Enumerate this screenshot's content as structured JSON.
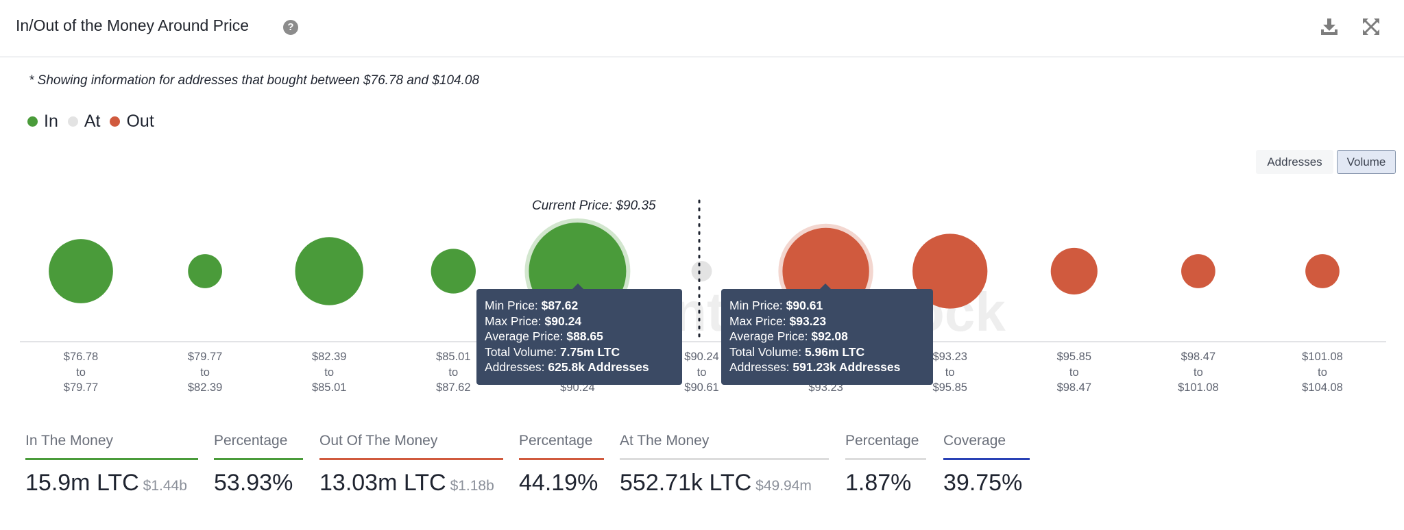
{
  "header": {
    "title": "In/Out of the Money Around Price",
    "help_icon": "question-circle-icon",
    "download_icon": "download-icon",
    "expand_icon": "expand-arrows-icon"
  },
  "note": "* Showing information for addresses that bought between $76.78 and $104.08",
  "legend": [
    {
      "label": "In",
      "color": "#4a9b3a"
    },
    {
      "label": "At",
      "color": "#e3e3e3"
    },
    {
      "label": "Out",
      "color": "#d05a3e"
    }
  ],
  "toggle": {
    "addresses_label": "Addresses",
    "volume_label": "Volume",
    "selected": "Volume"
  },
  "watermark": "IntoTheBlock",
  "chart_data": {
    "type": "bubble",
    "title": "In/Out of the Money Around Price",
    "current_price_label": "Current Price: $90.35",
    "current_price": 90.35,
    "size_metric": "Volume",
    "colors": {
      "In": "#4a9b3a",
      "At": "#e3e3e3",
      "Out": "#d05a3e"
    },
    "buckets": [
      {
        "from": "$76.78",
        "to": "$79.77",
        "status": "In",
        "relative_size": 0.66
      },
      {
        "from": "$79.77",
        "to": "$82.39",
        "status": "In",
        "relative_size": 0.35
      },
      {
        "from": "$82.39",
        "to": "$85.01",
        "status": "In",
        "relative_size": 0.7
      },
      {
        "from": "$85.01",
        "to": "$87.62",
        "status": "In",
        "relative_size": 0.46
      },
      {
        "from": "$87.62",
        "to": "$90.24",
        "status": "In",
        "relative_size": 1.0,
        "highlighted": true,
        "tooltip": {
          "min_price": "$87.62",
          "max_price": "$90.24",
          "avg_price": "$88.65",
          "total_volume": "7.75m LTC",
          "addresses": "625.8k Addresses"
        }
      },
      {
        "from": "$90.24",
        "to": "$90.61",
        "status": "At",
        "relative_size": 0.21
      },
      {
        "from": "$90.61",
        "to": "$93.23",
        "status": "Out",
        "relative_size": 0.89,
        "highlighted": true,
        "tooltip": {
          "min_price": "$90.61",
          "max_price": "$93.23",
          "avg_price": "$92.08",
          "total_volume": "5.96m LTC",
          "addresses": "591.23k Addresses"
        }
      },
      {
        "from": "$93.23",
        "to": "$95.85",
        "status": "Out",
        "relative_size": 0.77
      },
      {
        "from": "$95.85",
        "to": "$98.47",
        "status": "Out",
        "relative_size": 0.48
      },
      {
        "from": "$98.47",
        "to": "$101.08",
        "status": "Out",
        "relative_size": 0.35
      },
      {
        "from": "$101.08",
        "to": "$104.08",
        "status": "Out",
        "relative_size": 0.35
      }
    ],
    "tooltip_labels": {
      "min_price": "Min Price:",
      "max_price": "Max Price:",
      "avg_price": "Average Price:",
      "total_volume": "Total Volume:",
      "addresses": "Addresses:"
    },
    "tick_connector": "to"
  },
  "stats": [
    {
      "label": "In The Money",
      "value": "15.9m LTC",
      "sub": "$1.44b",
      "color": "#4a9b3a"
    },
    {
      "label": "Percentage",
      "value": "53.93%",
      "sub": "",
      "color": "#4a9b3a"
    },
    {
      "label": "Out Of The Money",
      "value": "13.03m LTC",
      "sub": "$1.18b",
      "color": "#d05a3e"
    },
    {
      "label": "Percentage",
      "value": "44.19%",
      "sub": "",
      "color": "#d05a3e"
    },
    {
      "label": "At The Money",
      "value": "552.71k LTC",
      "sub": "$49.94m",
      "color": "#dcdcdc"
    },
    {
      "label": "Percentage",
      "value": "1.87%",
      "sub": "",
      "color": "#dcdcdc"
    },
    {
      "label": "Coverage",
      "value": "39.75%",
      "sub": "",
      "color": "#2941b5"
    }
  ]
}
